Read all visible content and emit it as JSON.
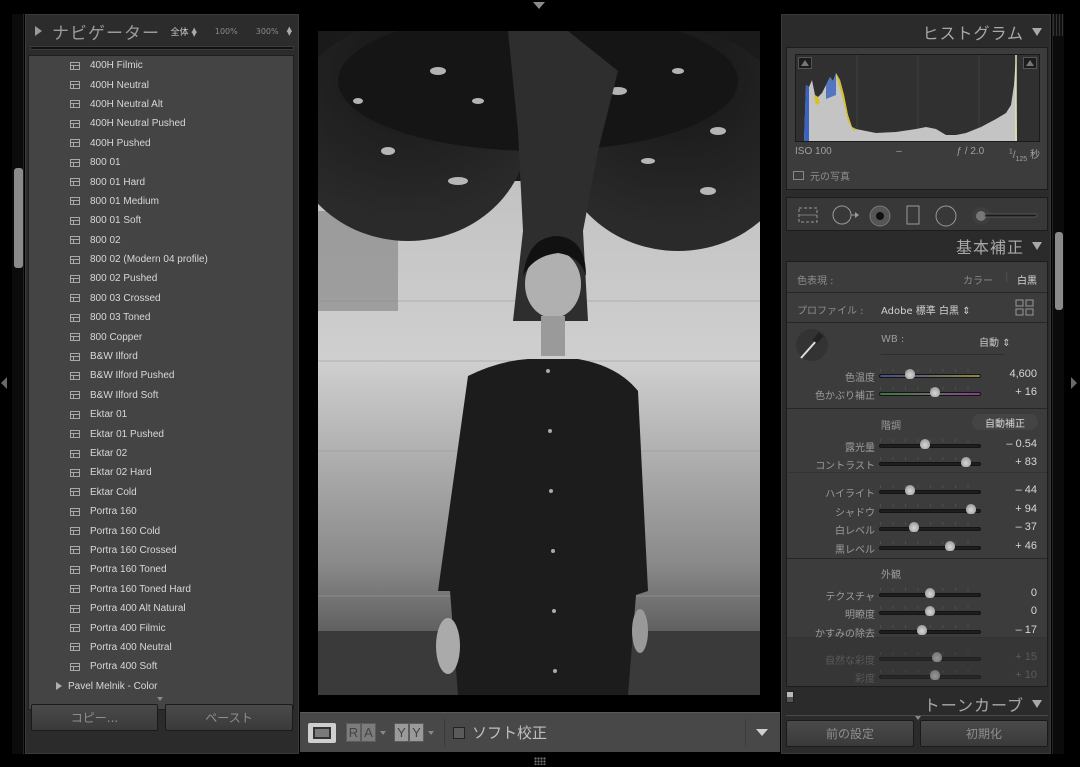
{
  "navigator": {
    "title": "ナビゲーター",
    "zoom_fit": "全体",
    "zoom_100": "100%",
    "zoom_300": "300%"
  },
  "presets": {
    "items": [
      "400H Filmic",
      "400H Neutral",
      "400H Neutral Alt",
      "400H Neutral Pushed",
      "400H Pushed",
      "800 01",
      "800 01 Hard",
      "800 01 Medium",
      "800 01 Soft",
      "800 02",
      "800 02 (Modern 04 profile)",
      "800 02 Pushed",
      "800 03 Crossed",
      "800 03 Toned",
      "800 Copper",
      "B&W Ilford",
      "B&W Ilford Pushed",
      "B&W Ilford Soft",
      "Ektar 01",
      "Ektar 01 Pushed",
      "Ektar 02",
      "Ektar 02 Hard",
      "Ektar Cold",
      "Portra 160",
      "Portra 160 Cold",
      "Portra 160 Crossed",
      "Portra 160 Toned",
      "Portra 160 Toned Hard",
      "Portra 400 Alt Natural",
      "Portra 400 Filmic",
      "Portra 400 Neutral",
      "Portra 400 Soft"
    ],
    "folder": "Pavel Melnik - Color"
  },
  "left_buttons": {
    "copy": "コピー...",
    "paste": "ペースト"
  },
  "toolbar": {
    "ra_left": "R",
    "ra_right": "A",
    "yy_left": "Y",
    "yy_right": "Y",
    "soft_proof": "ソフト校正"
  },
  "histogram": {
    "title": "ヒストグラム",
    "iso": "ISO 100",
    "focal": "–",
    "aperture": "ƒ / 2.0",
    "shutter_num": "1",
    "shutter_den": "125",
    "shutter_unit": "秒",
    "original_photo": "元の写真"
  },
  "basic": {
    "title": "基本補正",
    "treatment_label": "色表現 :",
    "treatment_color": "カラー",
    "treatment_bw": "白黒",
    "profile_label": "プロファイル :",
    "profile_value": "Adobe 標準 白黒",
    "wb_label": "WB :",
    "wb_value": "自動",
    "tone_label": "階調",
    "auto_label": "自動補正",
    "presence_label": "外観",
    "sliders": {
      "temp": {
        "label": "色温度",
        "value": "4,600",
        "position": 0.3
      },
      "tint": {
        "label": "色かぶり補正",
        "value": "+ 16",
        "position": 0.55
      },
      "exposure": {
        "label": "露光量",
        "value": "– 0.54",
        "position": 0.45
      },
      "contrast": {
        "label": "コントラスト",
        "value": "+ 83",
        "position": 0.86
      },
      "highlights": {
        "label": "ハイライト",
        "value": "– 44",
        "position": 0.3
      },
      "shadows": {
        "label": "シャドウ",
        "value": "+ 94",
        "position": 0.91
      },
      "whites": {
        "label": "白レベル",
        "value": "– 37",
        "position": 0.34
      },
      "blacks": {
        "label": "黒レベル",
        "value": "+ 46",
        "position": 0.7
      },
      "texture": {
        "label": "テクスチャ",
        "value": "0",
        "position": 0.5
      },
      "clarity": {
        "label": "明瞭度",
        "value": "0",
        "position": 0.5
      },
      "dehaze": {
        "label": "かすみの除去",
        "value": "– 17",
        "position": 0.42
      },
      "vibrance": {
        "label": "自然な彩度",
        "value": "+ 15",
        "position": 0.57
      },
      "saturation": {
        "label": "彩度",
        "value": "+ 10",
        "position": 0.55
      }
    }
  },
  "tone_curve": {
    "title": "トーンカーブ"
  },
  "right_buttons": {
    "previous": "前の設定",
    "reset": "初期化"
  }
}
